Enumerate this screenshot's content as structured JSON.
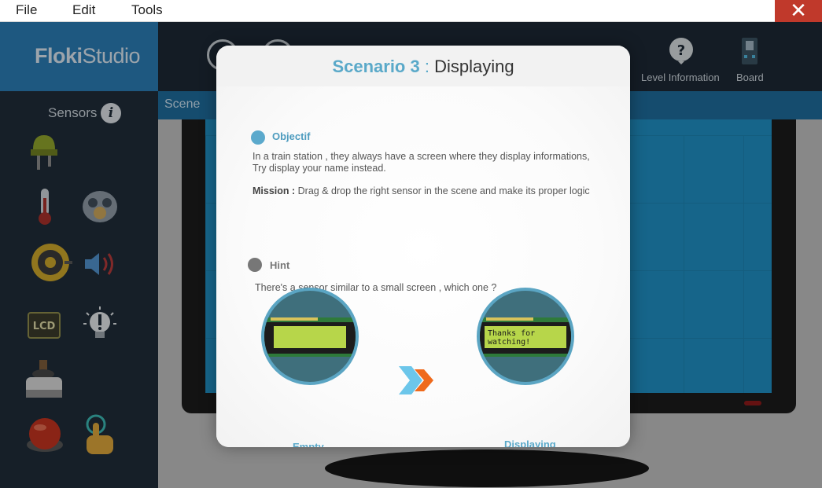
{
  "menubar": {
    "items": [
      "File",
      "Edit",
      "Tools"
    ],
    "close_label": "✕"
  },
  "sidebar": {
    "logo_bold": "Floki",
    "logo_light": "Studio",
    "sensors_title": "Sensors",
    "info_label": "i",
    "lcd_text": "LCD"
  },
  "toolbar": {
    "level_info_label": "Level Information",
    "board_label": "Board"
  },
  "scene": {
    "label": "Scene"
  },
  "modal": {
    "title_num": "Scenario 3",
    "title_sep": " : ",
    "title_text": "Displaying",
    "objective_title": "Objectif",
    "objective_line1": "In a train station , they always have a screen where they display informations,",
    "objective_line2": "Try display your name instead.",
    "mission_label": "Mission :",
    "mission_text": " Drag & drop the right sensor in the scene and make its proper logic",
    "hint_title": "Hint",
    "hint_text": "There's a sensor similar to a small screen , which one ?",
    "empty_caption": "Empty",
    "displaying_caption": "Displaying",
    "lcd_line1": "Thanks for",
    "lcd_line2": "watching!"
  },
  "colors": {
    "accent": "#5aa9c9",
    "objective_dot": "#5ba9cc",
    "hint_dot": "#777777",
    "lcd_green": "#b7d64a"
  }
}
